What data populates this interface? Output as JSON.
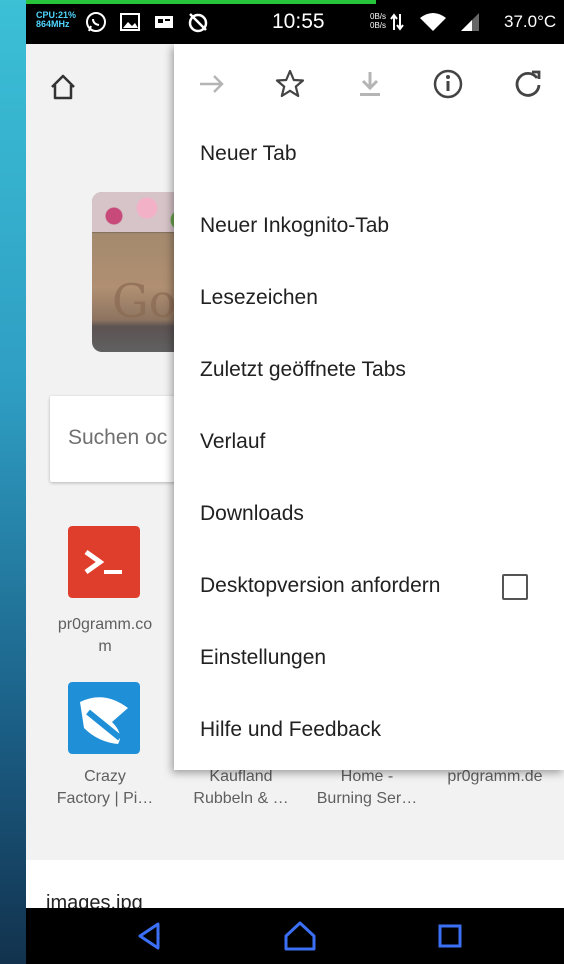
{
  "status_bar": {
    "cpu_line1": "CPU:21%",
    "cpu_line2": "864MHz",
    "time": "10:55",
    "net_up": "0B/s",
    "net_down": "0B/s",
    "temperature": "37.0°C",
    "icons": [
      "whatsapp-icon",
      "image-icon",
      "cast-icon",
      "no-alarm-icon",
      "data-transfer-icon",
      "wifi-icon",
      "signal-icon"
    ]
  },
  "page": {
    "search_placeholder": "Suchen oc",
    "tiles": [
      {
        "label_line1": "pr0gramm.co",
        "label_line2": "m",
        "icon": "terminal-icon",
        "color": "#e03e2d"
      },
      {
        "label_line1": "Crazy",
        "label_line2": "Factory | Pi…",
        "icon": "crazy-factory-icon",
        "color": "#1f8fd8"
      }
    ],
    "bottom_row_labels": [
      {
        "line1": "Kaufland",
        "line2": "Rubbeln & …"
      },
      {
        "line1": "Home -",
        "line2": "Burning Ser…"
      },
      {
        "line1": "pr0gramm.de",
        "line2": ""
      }
    ],
    "image_label": "images.jpg"
  },
  "menu": {
    "toolbar": [
      "forward-icon",
      "bookmark-star-icon",
      "download-icon",
      "info-icon",
      "reload-icon"
    ],
    "items": [
      {
        "label": "Neuer Tab"
      },
      {
        "label": "Neuer Inkognito-Tab"
      },
      {
        "label": "Lesezeichen"
      },
      {
        "label": "Zuletzt geöffnete Tabs"
      },
      {
        "label": "Verlauf"
      },
      {
        "label": "Downloads"
      },
      {
        "label": "Desktopversion anfordern",
        "checkbox": false
      },
      {
        "label": "Einstellungen"
      },
      {
        "label": "Hilfe und Feedback"
      }
    ]
  },
  "colors": {
    "accent_green": "#27c43b",
    "menu_bg": "#ffffff",
    "page_bg": "#f2f2f2"
  }
}
